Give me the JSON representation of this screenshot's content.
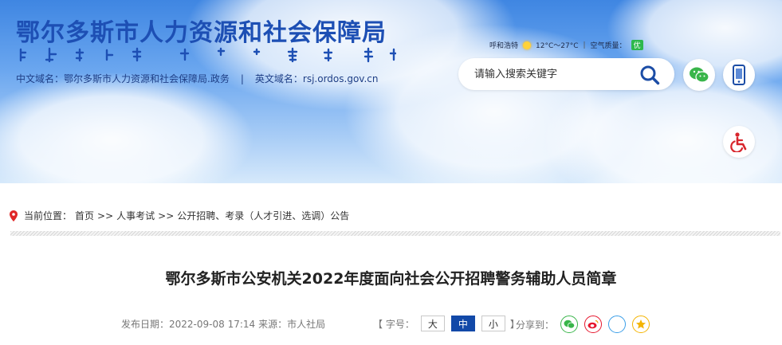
{
  "header": {
    "site_title": "鄂尔多斯市人力资源和社会保障局",
    "domain_cn_label": "中文域名：",
    "domain_cn_value": "鄂尔多斯市人力资源和社会保障局.政务",
    "separator": "|",
    "domain_en_label": "英文域名：",
    "domain_en_value": "rsj.ordos.gov.cn",
    "weather": {
      "city": "呼和浩特",
      "temperature": "12°C～27°C",
      "air_quality_label": "空气质量：",
      "air_quality_value": "优"
    },
    "search": {
      "placeholder": "请输入搜索关键字"
    },
    "icons": [
      "wechat-icon",
      "mobile-icon",
      "accessibility-icon"
    ]
  },
  "breadcrumb": {
    "label": "当前位置：",
    "items": [
      "首页",
      "人事考试",
      "公开招聘、考录（人才引进、选调）公告"
    ],
    "arrow": ">>"
  },
  "article": {
    "title": "鄂尔多斯市公安机关2022年度面向社会公开招聘警务辅助人员简章",
    "publish_label": "发布日期：",
    "publish_date": "2022-09-08 17:14",
    "source_label": "来源：",
    "source": "市人社局",
    "font_size_label": "【 字号：",
    "font_sizes": [
      "大",
      "中",
      "小"
    ],
    "font_close": "】",
    "share_label": "分享到：",
    "share_icons": [
      "wechat-share-icon",
      "weibo-share-icon",
      "qzone-share-icon",
      "qq-share-icon"
    ]
  },
  "colors": {
    "title_blue": "#1d4fb4",
    "active_button": "#1249a8",
    "wechat_green": "#39b54a",
    "weibo_red": "#e6162d",
    "qzone_blue": "#3a9ee8",
    "qq_yellow": "#f4b400"
  }
}
